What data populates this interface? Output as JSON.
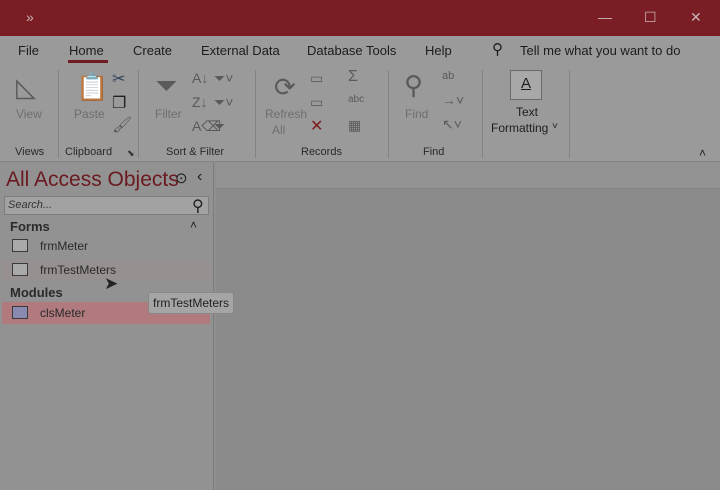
{
  "titlebar": {
    "quick_access": "»",
    "minimize": "—",
    "maximize": "☐",
    "close": "✕"
  },
  "tabs": [
    {
      "label": "File"
    },
    {
      "label": "Home",
      "active": true
    },
    {
      "label": "Create"
    },
    {
      "label": "External Data"
    },
    {
      "label": "Database Tools"
    },
    {
      "label": "Help"
    }
  ],
  "tell_me": "Tell me what you want to do",
  "ribbon": {
    "view": "View",
    "paste": "Paste",
    "filter": "Filter",
    "refresh": "Refresh",
    "refresh_all": "All",
    "find": "Find",
    "text": "Text",
    "formatting": "Formatting",
    "groups": [
      "Views",
      "Clipboard",
      "Sort & Filter",
      "Records",
      "Find"
    ]
  },
  "nav": {
    "title": "All Access Objects",
    "search_placeholder": "Search...",
    "groups": [
      {
        "label": "Forms",
        "items": [
          "frmMeter",
          "frmTestMeters"
        ]
      },
      {
        "label": "Modules",
        "items": [
          "clsMeter"
        ]
      }
    ]
  },
  "tooltip": "frmTestMeters",
  "colors": {
    "accent": "#a4262c",
    "selected": "#c98a8e"
  }
}
